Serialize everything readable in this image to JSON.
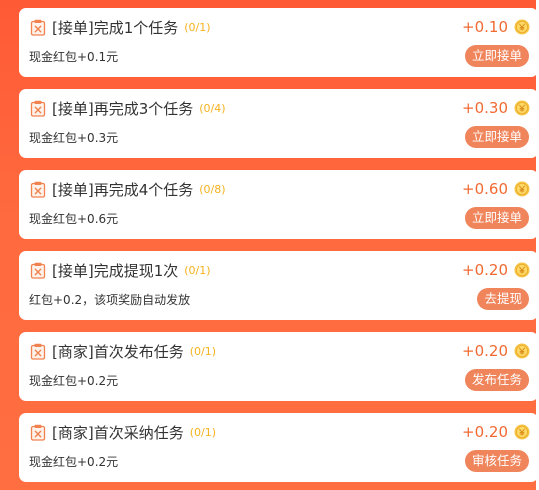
{
  "tasks": [
    {
      "title": "[接单]完成1个任务",
      "progress": "(0/1)",
      "reward": "+0.10",
      "desc": "现金红包+0.1元",
      "action": "立即接单"
    },
    {
      "title": "[接单]再完成3个任务",
      "progress": "(0/4)",
      "reward": "+0.30",
      "desc": "现金红包+0.3元",
      "action": "立即接单"
    },
    {
      "title": "[接单]再完成4个任务",
      "progress": "(0/8)",
      "reward": "+0.60",
      "desc": "现金红包+0.6元",
      "action": "立即接单"
    },
    {
      "title": "[接单]完成提现1次",
      "progress": "(0/1)",
      "reward": "+0.20",
      "desc": "红包+0.2，该项奖励自动发放",
      "action": "去提现"
    },
    {
      "title": "[商家]首次发布任务",
      "progress": "(0/1)",
      "reward": "+0.20",
      "desc": "现金红包+0.2元",
      "action": "发布任务"
    },
    {
      "title": "[商家]首次采纳任务",
      "progress": "(0/1)",
      "reward": "+0.20",
      "desc": "现金红包+0.2元",
      "action": "审核任务"
    }
  ],
  "icons": {
    "task": "task-clipboard-icon",
    "coin": "coin-icon"
  },
  "colors": {
    "background": "#ff5a36",
    "progress": "#f5b21d",
    "reward": "#f06a32",
    "button": "#f0845b",
    "coin": "#f7c343"
  }
}
